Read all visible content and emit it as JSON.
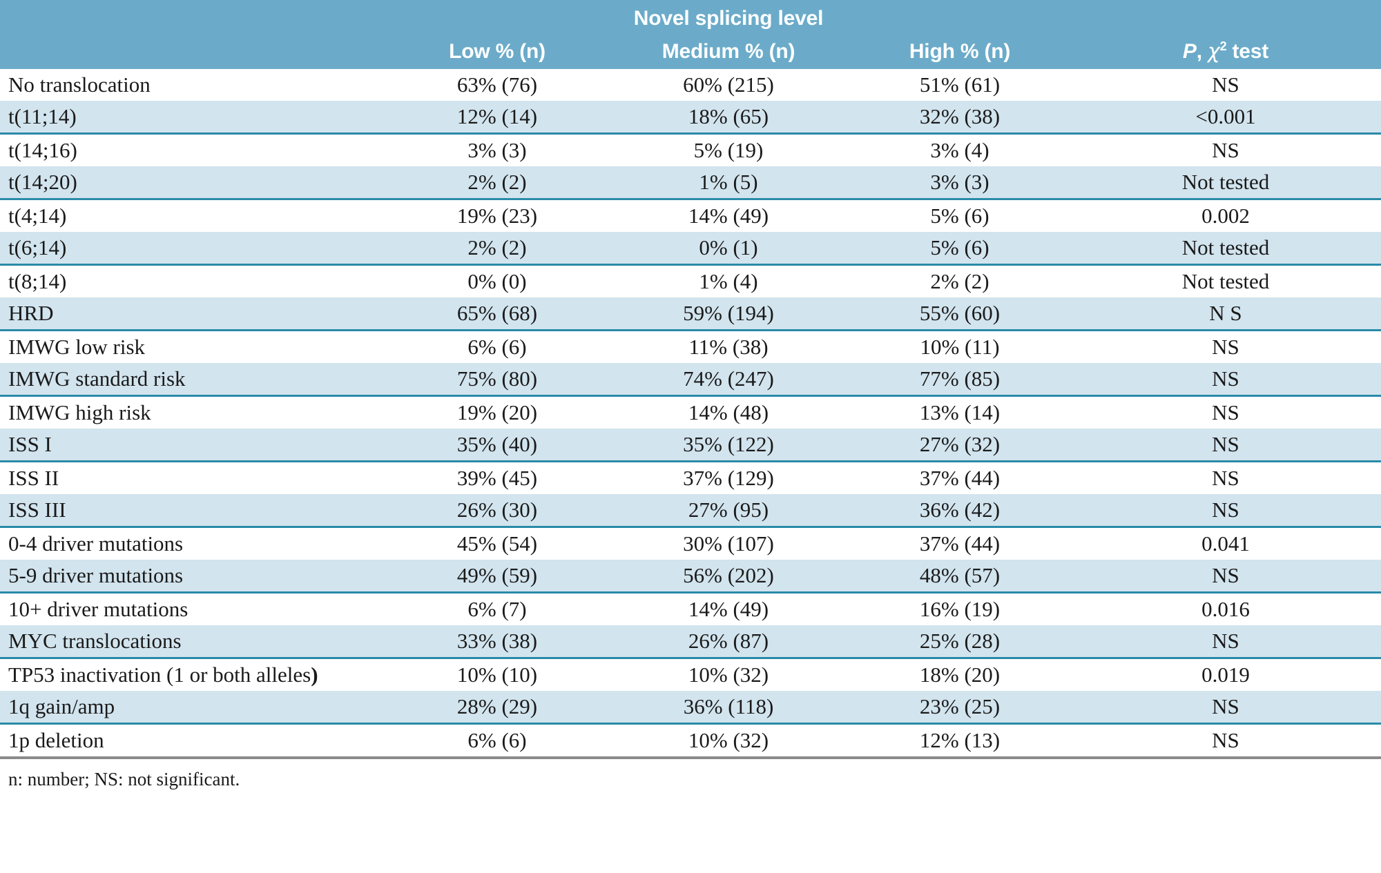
{
  "header": {
    "group_title": "Novel splicing level",
    "columns": [
      {
        "key": "label",
        "label": ""
      },
      {
        "key": "low",
        "label": "Low % (n)"
      },
      {
        "key": "medium",
        "label": "Medium % (n)"
      },
      {
        "key": "high",
        "label": "High % (n)"
      },
      {
        "key": "p",
        "label": "P, χ² test",
        "p_prefix": "P",
        "comma": ",",
        "chi": "χ",
        "sup": "2",
        "suffix": "test"
      }
    ]
  },
  "rows": [
    {
      "label": "No translocation",
      "low": "63% (76)",
      "medium": "60% (215)",
      "high": "51% (61)",
      "p": "NS",
      "shaded": false
    },
    {
      "label": "t(11;14)",
      "low": "12% (14)",
      "medium": "18% (65)",
      "high": "32% (38)",
      "p": "<0.001",
      "shaded": true
    },
    {
      "label": "t(14;16)",
      "low": "3% (3)",
      "medium": "5% (19)",
      "high": "3% (4)",
      "p": "NS",
      "shaded": false
    },
    {
      "label": "t(14;20)",
      "low": "2% (2)",
      "medium": "1% (5)",
      "high": "3% (3)",
      "p": "Not tested",
      "shaded": true
    },
    {
      "label": "t(4;14)",
      "low": "19% (23)",
      "medium": "14% (49)",
      "high": "5% (6)",
      "p": "0.002",
      "shaded": false
    },
    {
      "label": "t(6;14)",
      "low": "2% (2)",
      "medium": "0% (1)",
      "high": "5% (6)",
      "p": "Not tested",
      "shaded": true
    },
    {
      "label": "t(8;14)",
      "low": "0% (0)",
      "medium": "1% (4)",
      "high": "2% (2)",
      "p": "Not tested",
      "shaded": false
    },
    {
      "label": "HRD",
      "low": "65% (68)",
      "medium": "59% (194)",
      "high": "55% (60)",
      "p": "N S",
      "shaded": true
    },
    {
      "label": "IMWG low risk",
      "low": "6% (6)",
      "medium": "11% (38)",
      "high": "10% (11)",
      "p": "NS",
      "shaded": false
    },
    {
      "label": "IMWG standard risk",
      "low": "75% (80)",
      "medium": "74% (247)",
      "high": "77% (85)",
      "p": "NS",
      "shaded": true
    },
    {
      "label": "IMWG high risk",
      "low": "19% (20)",
      "medium": "14% (48)",
      "high": "13% (14)",
      "p": "NS",
      "shaded": false
    },
    {
      "label": "ISS I",
      "low": "35% (40)",
      "medium": "35% (122)",
      "high": "27% (32)",
      "p": "NS",
      "shaded": true
    },
    {
      "label": "ISS II",
      "low": "39% (45)",
      "medium": "37% (129)",
      "high": "37% (44)",
      "p": "NS",
      "shaded": false
    },
    {
      "label": "ISS III",
      "low": "26% (30)",
      "medium": "27% (95)",
      "high": "36% (42)",
      "p": "NS",
      "shaded": true
    },
    {
      "label": "0-4 driver mutations",
      "low": "45% (54)",
      "medium": "30% (107)",
      "high": "37% (44)",
      "p": "0.041",
      "shaded": false
    },
    {
      "label": "5-9 driver mutations",
      "low": "49% (59)",
      "medium": "56% (202)",
      "high": "48% (57)",
      "p": "NS",
      "shaded": true
    },
    {
      "label": "10+ driver mutations",
      "low": "6% (7)",
      "medium": "14% (49)",
      "high": "16% (19)",
      "p": "0.016",
      "shaded": false
    },
    {
      "label": "MYC translocations",
      "low": "33% (38)",
      "medium": "26% (87)",
      "high": "25% (28)",
      "p": "NS",
      "shaded": true
    },
    {
      "label": "TP53 inactivation (1 or both alleles)",
      "low": "10% (10)",
      "medium": "10% (32)",
      "high": "18% (20)",
      "p": "0.019",
      "shaded": false
    },
    {
      "label": "1q gain/amp",
      "low": "28% (29)",
      "medium": "36% (118)",
      "high": "23% (25)",
      "p": "NS",
      "shaded": true
    },
    {
      "label": "1p deletion",
      "low": "6% (6)",
      "medium": "10% (32)",
      "high": "12% (13)",
      "p": "NS",
      "shaded": false
    }
  ],
  "footnote": "n: number; NS: not significant.",
  "colors": {
    "header_bg": "#6babc9",
    "shaded_row_bg": "#d2e4ee",
    "row_rule": "#2a8aa8",
    "bottom_rule": "#8a8a8a",
    "header_text": "#ffffff",
    "body_text": "#1a1a1a"
  }
}
